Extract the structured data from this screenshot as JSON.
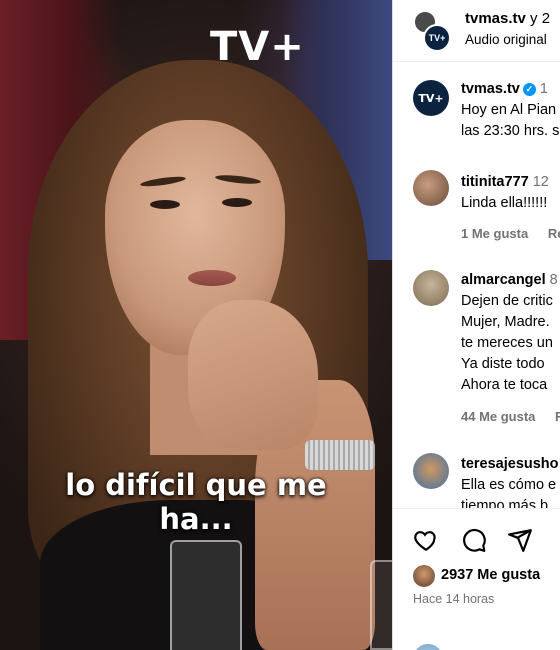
{
  "video": {
    "logo": "TV+",
    "subtitle_line1": "lo difícil que me",
    "subtitle_line2": "ha..."
  },
  "header": {
    "username": "tvmas.tv",
    "collab_suffix": "y 2",
    "subtitle": "Audio original",
    "avatar_text": "TV+"
  },
  "caption": {
    "username": "tvmas.tv",
    "verified": true,
    "time": "1",
    "line1": "Hoy en Al Pian",
    "line2": "las 23:30 hrs. s",
    "avatar_text": "TV+"
  },
  "comments": [
    {
      "username": "titinita777",
      "time": "12",
      "lines": [
        "Linda ella!!!!!!"
      ],
      "likes": "1 Me gusta",
      "reply": "Re"
    },
    {
      "username": "almarcangel",
      "time": "8",
      "lines": [
        "Dejen de critic",
        "Mujer, Madre.",
        "te mereces un",
        "Ya diste todo",
        "Ahora te toca"
      ],
      "likes": "44 Me gusta",
      "reply": "Re"
    },
    {
      "username": "teresajesusho",
      "time": "",
      "lines": [
        "Ella es cómo e",
        "tiempo más b"
      ],
      "likes": "",
      "reply": ""
    }
  ],
  "footer": {
    "likes_count": "2937",
    "likes_label": "Me gusta",
    "posted_ago": "Hace 14 horas"
  },
  "colors": {
    "verified": "#0095f6",
    "muted_text": "#737373",
    "brand_avatar": "#0c2340"
  },
  "icons": [
    "heart-icon",
    "comment-icon",
    "share-icon",
    "verified-icon"
  ]
}
